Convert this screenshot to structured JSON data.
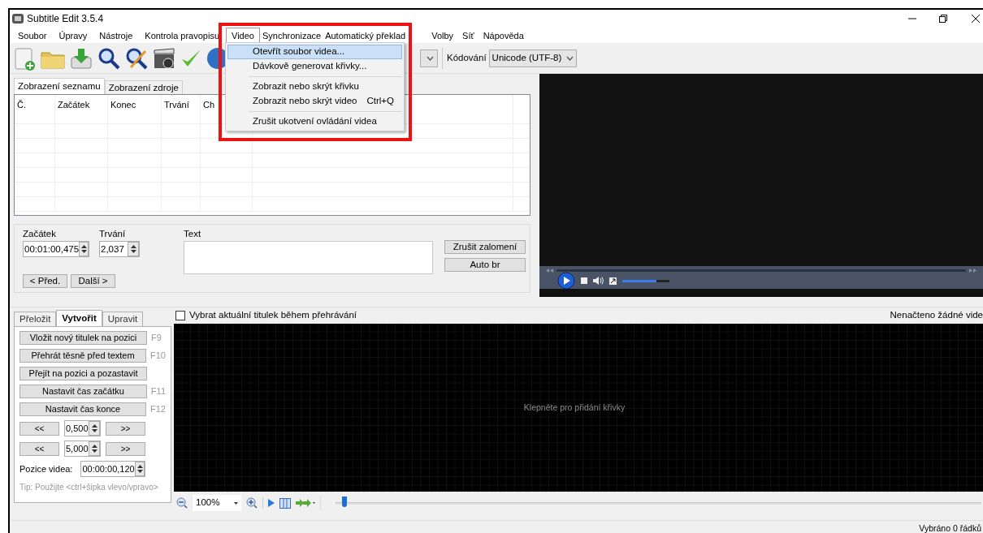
{
  "window": {
    "title": "Subtitle Edit 3.5.4"
  },
  "menu_bar": [
    {
      "label": "Soubor",
      "selected": false
    },
    {
      "label": "Úpravy",
      "selected": false
    },
    {
      "label": "Nástroje",
      "selected": false
    },
    {
      "label": "Kontrola pravopisu",
      "selected": false
    },
    {
      "label": "Video",
      "selected": true
    },
    {
      "label": "Synchronizace",
      "selected": false
    },
    {
      "label": "Automatický překlad",
      "selected": false
    },
    {
      "label": "Volby",
      "selected": false
    },
    {
      "label": "Síť",
      "selected": false
    },
    {
      "label": "Nápověda",
      "selected": false
    }
  ],
  "video_menu": [
    {
      "kind": "item",
      "label": "Otevřít soubor videa...",
      "selected": true
    },
    {
      "kind": "item",
      "label": "Dávkově generovat křivky...",
      "selected": false
    },
    {
      "kind": "separator"
    },
    {
      "kind": "item",
      "label": "Zobrazit nebo skrýt křivku",
      "selected": false
    },
    {
      "kind": "item",
      "label": "Zobrazit nebo skrýt video",
      "shortcut": "Ctrl+Q",
      "selected": false
    },
    {
      "kind": "separator"
    },
    {
      "kind": "item",
      "label": "Zrušit ukotvení ovládání videa",
      "selected": false
    }
  ],
  "toolbar": {
    "encoding_label": "Kódování",
    "encoding": "Unicode (UTF-8)"
  },
  "view_tabs": [
    {
      "label": "Zobrazení seznamu",
      "selected": true
    },
    {
      "label": "Zobrazení zdroje",
      "selected": false
    }
  ],
  "table": {
    "columns": [
      "Č.",
      "Začátek",
      "Konec",
      "Trvání",
      "Ch"
    ]
  },
  "editor": {
    "start_label": "Začátek",
    "start": "00:01:00,475",
    "duration_label": "Trvání",
    "duration": "2,037",
    "text_label": "Text",
    "buttons": [
      "Zrušit zalomení",
      "Auto br"
    ],
    "prev": "< Před.",
    "next": "Další >"
  },
  "player": {
    "volume": {
      "level": 0.72
    }
  },
  "mode_tabs": [
    {
      "label": "Přeložit",
      "selected": false
    },
    {
      "label": "Vytvořit",
      "selected": true
    },
    {
      "label": "Upravit",
      "selected": false
    }
  ],
  "create_actions": [
    {
      "label": "Vložit nový titulek na pozici",
      "shortcut": "F9"
    },
    {
      "label": "Přehrát těsně před textem",
      "shortcut": "F10"
    },
    {
      "label": "Přejít na pozici a pozastavit"
    },
    {
      "label": "Nastavit čas začátku",
      "shortcut": "F11"
    },
    {
      "label": "Nastavit čas konce",
      "shortcut": "F12"
    }
  ],
  "steppers": [
    {
      "back": "<<",
      "value": "0,500",
      "forward": ">>"
    },
    {
      "back": "<<",
      "value": "5,000",
      "forward": ">>"
    }
  ],
  "video_position": {
    "label": "Pozice videa:",
    "value": "00:00:00,120"
  },
  "tip": "Tip: Použijte <ctrl+šipka vlevo/vpravo>",
  "waveform": {
    "follow_checkbox": {
      "label": "Vybrat aktuální titulek během přehrávání",
      "checked": false
    },
    "status": "Nenačteno žádné vide",
    "hint": "Klepněte pro přidání křivky",
    "zoom": "100%",
    "position": {
      "level": 0.01
    }
  },
  "status_bar": {
    "text": "Vybráno 0 řádků"
  }
}
